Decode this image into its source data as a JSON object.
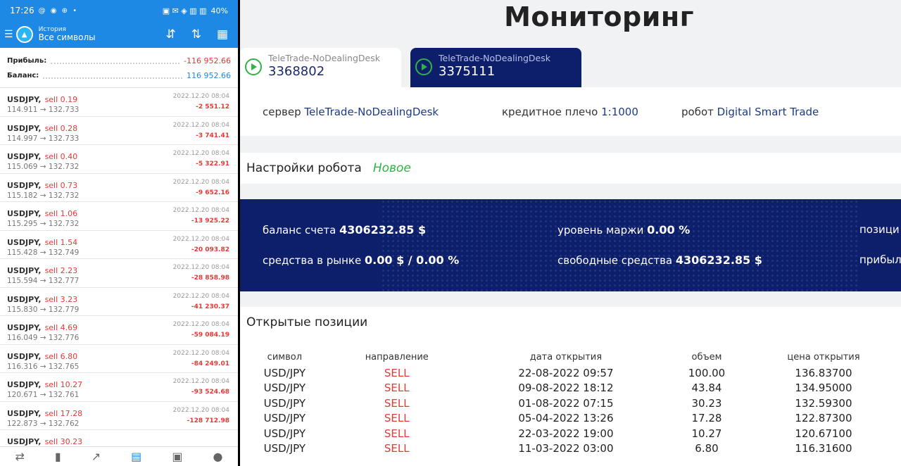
{
  "status_bar": {
    "time": "17:26",
    "left_icons": "@ ◉ ⊕ •",
    "right_icons": "▣ ✉ ◈ ▥ ▥",
    "battery": "40%"
  },
  "app_bar": {
    "subtitle": "История",
    "title": "Все символы"
  },
  "summary": {
    "profit_label": "Прибыль:",
    "profit_value": "-116 952.66",
    "balance_label": "Баланс:",
    "balance_value": "116 952.66"
  },
  "trades": [
    {
      "symbol": "USDJPY,",
      "direction": "sell 0.19",
      "prices": "114.911 → 132.733",
      "date": "2022.12.20 08:04",
      "profit": "-2 551.12"
    },
    {
      "symbol": "USDJPY,",
      "direction": "sell 0.28",
      "prices": "114.997 → 132.733",
      "date": "2022.12.20 08:04",
      "profit": "-3 741.41"
    },
    {
      "symbol": "USDJPY,",
      "direction": "sell 0.40",
      "prices": "115.069 → 132.732",
      "date": "2022.12.20 08:04",
      "profit": "-5 322.91"
    },
    {
      "symbol": "USDJPY,",
      "direction": "sell 0.73",
      "prices": "115.182 → 132.732",
      "date": "2022.12.20 08:04",
      "profit": "-9 652.16"
    },
    {
      "symbol": "USDJPY,",
      "direction": "sell 1.06",
      "prices": "115.295 → 132.732",
      "date": "2022.12.20 08:04",
      "profit": "-13 925.22"
    },
    {
      "symbol": "USDJPY,",
      "direction": "sell 1.54",
      "prices": "115.428 → 132.749",
      "date": "2022.12.20 08:04",
      "profit": "-20 093.82"
    },
    {
      "symbol": "USDJPY,",
      "direction": "sell 2.23",
      "prices": "115.594 → 132.777",
      "date": "2022.12.20 08:04",
      "profit": "-28 858.98"
    },
    {
      "symbol": "USDJPY,",
      "direction": "sell 3.23",
      "prices": "115.830 → 132.779",
      "date": "2022.12.20 08:04",
      "profit": "-41 230.37"
    },
    {
      "symbol": "USDJPY,",
      "direction": "sell 4.69",
      "prices": "116.049 → 132.776",
      "date": "2022.12.20 08:04",
      "profit": "-59 084.19"
    },
    {
      "symbol": "USDJPY,",
      "direction": "sell 6.80",
      "prices": "116.316 → 132.765",
      "date": "2022.12.20 08:04",
      "profit": "-84 249.01"
    },
    {
      "symbol": "USDJPY,",
      "direction": "sell 10.27",
      "prices": "120.671 → 132.761",
      "date": "2022.12.20 08:04",
      "profit": "-93 524.68"
    },
    {
      "symbol": "USDJPY,",
      "direction": "sell 17.28",
      "prices": "122.873 → 132.762",
      "date": "2022.12.20 08:04",
      "profit": "-128 712.98"
    },
    {
      "symbol": "USDJPY,",
      "direction": "sell 30.23",
      "prices": "",
      "date": "",
      "profit": ""
    }
  ],
  "bottom_nav": [
    "quotes-icon",
    "chart-icon",
    "trade-icon",
    "history-icon",
    "news-icon",
    "chat-icon"
  ],
  "monitor": {
    "title": "Мониторинг",
    "tabs": [
      {
        "server": "TeleTrade-NoDealingDesk",
        "account": "3368802"
      },
      {
        "server": "TeleTrade-NoDealingDesk",
        "account": "3375111"
      }
    ],
    "info": {
      "server_label": "сервер",
      "server_value": "TeleTrade-NoDealingDesk",
      "leverage_label": "кредитное плечо",
      "leverage_value": "1:1000",
      "robot_label": "робот",
      "robot_value": "Digital Smart Trade"
    },
    "settings": {
      "label": "Настройки робота",
      "value": "Новое"
    },
    "stats": {
      "balance_label": "баланс счета",
      "balance_value": "4306232.85 $",
      "margin_label": "уровень маржи",
      "margin_value": "0.00 %",
      "positions_label": "позици",
      "market_label": "средства в рынке",
      "market_value": "0.00 $ / 0.00 %",
      "free_label": "свободные средства",
      "free_value": "4306232.85 $",
      "profit_label": "прибыл"
    },
    "positions_title": "Открытые позиции",
    "columns": [
      "символ",
      "направление",
      "дата открытия",
      "объем",
      "цена открытия"
    ],
    "rows": [
      [
        "USD/JPY",
        "SELL",
        "22-08-2022 09:57",
        "100.00",
        "136.83700"
      ],
      [
        "USD/JPY",
        "SELL",
        "09-08-2022 18:12",
        "43.84",
        "134.95000"
      ],
      [
        "USD/JPY",
        "SELL",
        "01-08-2022 07:15",
        "30.23",
        "132.59300"
      ],
      [
        "USD/JPY",
        "SELL",
        "05-04-2022 13:26",
        "17.28",
        "122.87300"
      ],
      [
        "USD/JPY",
        "SELL",
        "22-03-2022 19:00",
        "10.27",
        "120.67100"
      ],
      [
        "USD/JPY",
        "SELL",
        "11-03-2022 03:00",
        "6.80",
        "116.31600"
      ]
    ]
  }
}
